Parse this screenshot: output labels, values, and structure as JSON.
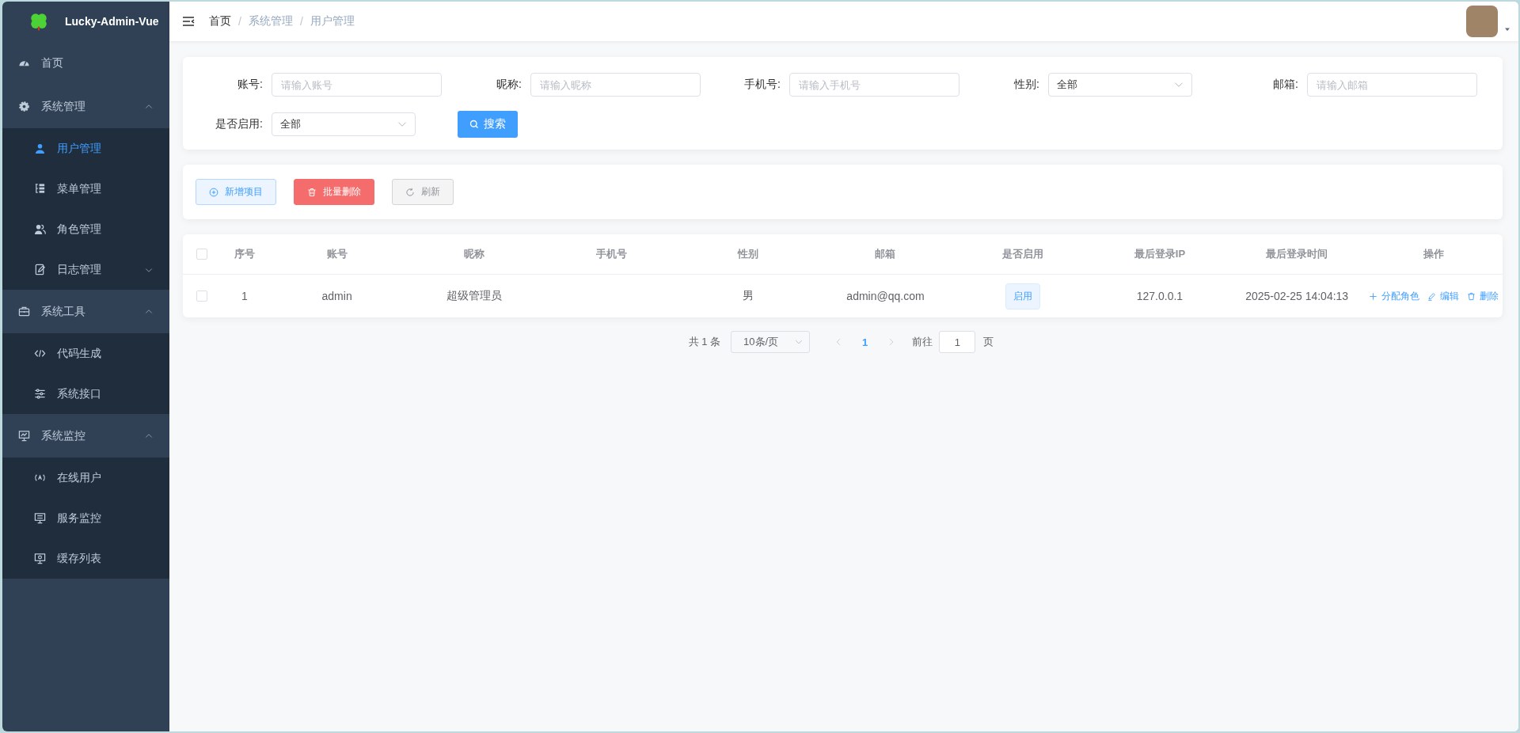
{
  "sidebar": {
    "title": "Lucky-Admin-Vue",
    "items": [
      {
        "label": "首页",
        "selected": false
      },
      {
        "label": "系统管理",
        "expanded": true,
        "children": [
          {
            "label": "用户管理",
            "selected": true
          },
          {
            "label": "菜单管理",
            "selected": false
          },
          {
            "label": "角色管理",
            "selected": false
          },
          {
            "label": "日志管理",
            "expanded": false
          }
        ]
      },
      {
        "label": "系统工具",
        "expanded": true,
        "children": [
          {
            "label": "代码生成",
            "selected": false
          },
          {
            "label": "系统接口",
            "selected": false
          }
        ]
      },
      {
        "label": "系统监控",
        "expanded": true,
        "children": [
          {
            "label": "在线用户",
            "selected": false
          },
          {
            "label": "服务监控",
            "selected": false
          },
          {
            "label": "缓存列表",
            "selected": false
          }
        ]
      }
    ]
  },
  "breadcrumb": [
    {
      "label": "首页",
      "link": true
    },
    {
      "separator": "/",
      "label": "系统管理",
      "link": false
    },
    {
      "separator": "/",
      "label": "用户管理",
      "link": false
    }
  ],
  "search": {
    "fields": [
      {
        "label": "账号:",
        "kind": "input",
        "placeholder": "请输入账号"
      },
      {
        "label": "昵称:",
        "kind": "input",
        "placeholder": "请输入昵称"
      },
      {
        "label": "手机号:",
        "kind": "input",
        "placeholder": "请输入手机号"
      },
      {
        "label": "性别:",
        "kind": "select",
        "value": "全部"
      },
      {
        "label": "邮箱:",
        "kind": "input",
        "placeholder": "请输入邮箱"
      },
      {
        "label": "是否启用:",
        "kind": "select",
        "value": "全部"
      }
    ],
    "button": "搜索"
  },
  "toolbar": [
    {
      "label": "新增项目",
      "kind": "add"
    },
    {
      "label": "批量删除",
      "kind": "danger"
    },
    {
      "label": "刷新",
      "kind": "refresh"
    }
  ],
  "table": {
    "all_checked": false,
    "columns": [
      "序号",
      "账号",
      "昵称",
      "手机号",
      "性别",
      "邮箱",
      "是否启用",
      "最后登录IP",
      "最后登录时间",
      "操作"
    ],
    "rows": [
      {
        "checked": false,
        "index": "1",
        "account": "admin",
        "nickname": "超级管理员",
        "gender": "男",
        "email": "admin@qq.com",
        "status": {
          "label": "启用",
          "on": true
        },
        "ip": "127.0.0.1",
        "last_login": "2025-02-25 14:04:13",
        "actions": [
          "分配角色",
          "编辑",
          "删除"
        ]
      }
    ]
  },
  "pagination": {
    "total": "共 1 条",
    "page_size": "10条/页",
    "pages": [
      {
        "label": "1",
        "selected": true
      }
    ],
    "goto_label": "前往",
    "goto_value": "1",
    "goto_suffix": "页"
  }
}
